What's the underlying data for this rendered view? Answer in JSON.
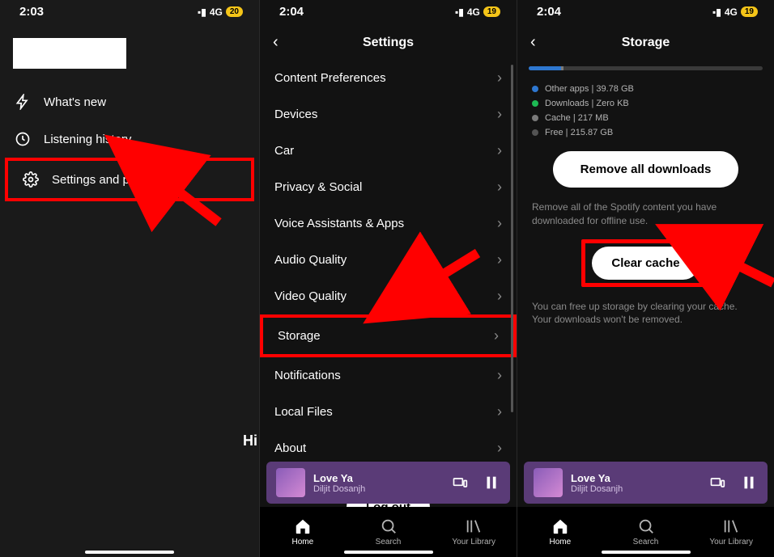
{
  "screen1": {
    "time": "2:03",
    "signal": "4G",
    "battery": "20",
    "menu": {
      "whatsnew": "What's new",
      "history": "Listening history",
      "settings": "Settings and privacy"
    }
  },
  "screen2": {
    "time": "2:04",
    "signal": "4G",
    "battery": "19",
    "title": "Settings",
    "items": {
      "content": "Content Preferences",
      "devices": "Devices",
      "car": "Car",
      "privacy": "Privacy & Social",
      "voice": "Voice Assistants & Apps",
      "audio": "Audio Quality",
      "video": "Video Quality",
      "storage": "Storage",
      "notifications": "Notifications",
      "local": "Local Files",
      "about": "About"
    },
    "logout": "Log out",
    "nowplaying": {
      "title": "Love Ya",
      "artist": "Diljit Dosanjh"
    },
    "nav": {
      "home": "Home",
      "search": "Search",
      "library": "Your Library"
    }
  },
  "screen3": {
    "time": "2:04",
    "signal": "4G",
    "battery": "19",
    "title": "Storage",
    "legend": {
      "other": "Other apps | 39.78 GB",
      "downloads": "Downloads | Zero KB",
      "cache": "Cache | 217 MB",
      "free": "Free | 215.87 GB"
    },
    "remove_btn": "Remove all downloads",
    "remove_desc": "Remove all of the Spotify content you have downloaded for offline use.",
    "clear_btn": "Clear cache",
    "clear_desc": "You can free up storage by clearing your cache. Your downloads won't be removed.",
    "nowplaying": {
      "title": "Love Ya",
      "artist": "Diljit Dosanjh"
    },
    "nav": {
      "home": "Home",
      "search": "Search",
      "library": "Your Library"
    },
    "colors": {
      "other": "#2e77d0",
      "downloads": "#1db954",
      "cache": "#7a7a7a",
      "free": "#535353"
    }
  },
  "peek_hi": "Hi"
}
